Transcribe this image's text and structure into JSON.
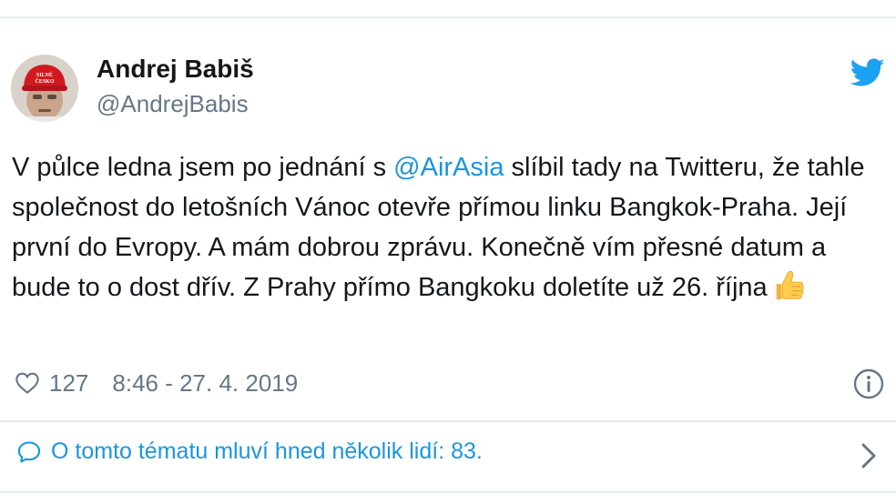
{
  "tweet": {
    "author_name": "Andrej Babiš",
    "author_handle": "@AndrejBabis",
    "avatar_cap_text": "SILNÉ ČESKO",
    "text_before_mention": "V půlce ledna jsem po jednání s ",
    "mention": "@AirAsia",
    "text_after_mention": " slíbil tady na Twitteru, že tahle společnost do letošních Vánoc otevře přímou linku Bangkok-Praha. Její první do Evropy. A mám dobrou zprávu. Konečně vím přesné datum a bude to o dost dřív. Z Prahy přímo Bangkoku doletíte už 26. října",
    "likes": "127",
    "timestamp": "8:46 - 27. 4. 2019"
  },
  "footer": {
    "discussion_text": "O tomto tématu mluví hned několik lidí: 83."
  },
  "icons": {
    "logo": "twitter-bird-icon",
    "like": "heart-icon",
    "info": "info-icon",
    "reply": "speech-bubble-icon",
    "more": "chevron-right-icon",
    "emoji": "thumbs-up-emoji-icon"
  },
  "colors": {
    "accent": "#1b95e0",
    "text": "#14171a",
    "secondary": "#657786",
    "border": "#e6ecf0",
    "twitter_blue": "#1da1f2"
  }
}
